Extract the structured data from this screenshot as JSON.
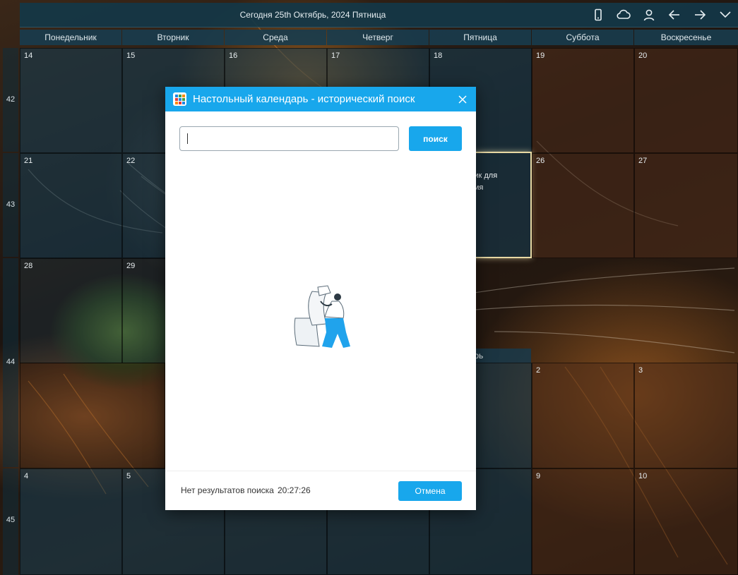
{
  "topbar": {
    "title": "Сегодня 25th Октябрь, 2024 Пятница",
    "icons": [
      "phone-icon",
      "cloud-icon",
      "user-icon",
      "arrow-left-icon",
      "arrow-right-icon",
      "chevron-down-icon"
    ]
  },
  "calendar": {
    "day_headers": [
      "Понедельник",
      "Вторник",
      "Среда",
      "Четверг",
      "Пятница",
      "Суббота",
      "Воскресенье"
    ],
    "week_numbers": [
      "42",
      "43",
      "44",
      "45"
    ],
    "weeks": [
      [
        "14",
        "15",
        "16",
        "17",
        "18",
        "19",
        "20"
      ],
      [
        "21",
        "22",
        "",
        "",
        "",
        "26",
        "27"
      ],
      [
        "28",
        "29",
        "",
        "",
        "",
        "2",
        "3"
      ],
      [
        "4",
        "5",
        "",
        "",
        "",
        "9",
        "10"
      ]
    ],
    "today_hint_lines": [
      "клик для",
      "ания"
    ],
    "month_label": "ябрь"
  },
  "dialog": {
    "title": "Настольный календарь - исторический поиск",
    "search_value": "",
    "search_button": "поиск",
    "status_label": "Нет результатов поиска",
    "status_time": "20:27:26",
    "cancel_button": "Отмена"
  },
  "colors": {
    "accent": "#18a7ec",
    "weekday_cell": "#163e54",
    "weekend_cell": "#502d19"
  }
}
